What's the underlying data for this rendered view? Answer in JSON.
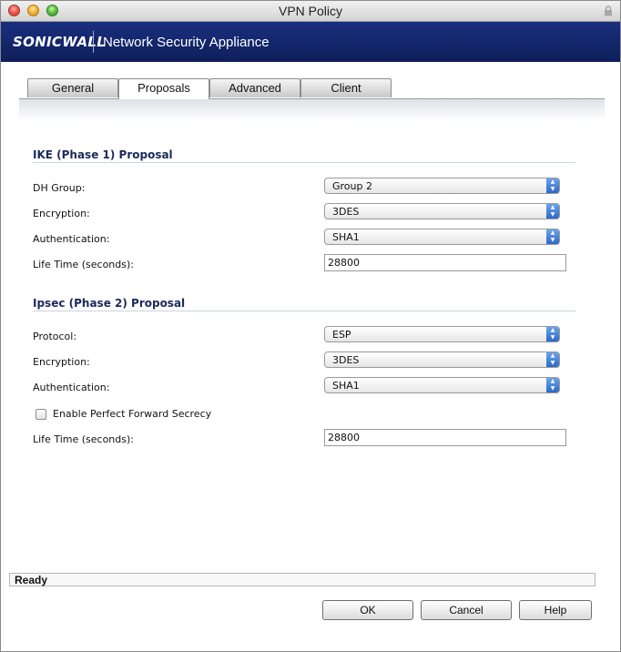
{
  "window": {
    "title": "VPN Policy"
  },
  "brand": {
    "logo": "SONICWALL",
    "product": "Network Security Appliance"
  },
  "tabs": [
    {
      "label": "General",
      "active": false
    },
    {
      "label": "Proposals",
      "active": true
    },
    {
      "label": "Advanced",
      "active": false
    },
    {
      "label": "Client",
      "active": false
    }
  ],
  "ike": {
    "title": "IKE (Phase 1) Proposal",
    "dh_group": {
      "label": "DH Group:",
      "value": "Group 2"
    },
    "encryption": {
      "label": "Encryption:",
      "value": "3DES"
    },
    "authentication": {
      "label": "Authentication:",
      "value": "SHA1"
    },
    "lifetime": {
      "label": "Life Time (seconds):",
      "value": "28800"
    }
  },
  "ipsec": {
    "title": "Ipsec (Phase 2) Proposal",
    "protocol": {
      "label": "Protocol:",
      "value": "ESP"
    },
    "encryption": {
      "label": "Encryption:",
      "value": "3DES"
    },
    "authentication": {
      "label": "Authentication:",
      "value": "SHA1"
    },
    "pfs": {
      "label": "Enable Perfect Forward Secrecy",
      "checked": false
    },
    "lifetime": {
      "label": "Life Time (seconds):",
      "value": "28800"
    }
  },
  "status": {
    "text": "Ready"
  },
  "buttons": {
    "ok": "OK",
    "cancel": "Cancel",
    "help": "Help"
  },
  "colors": {
    "brand_bar": "#0e1f5a",
    "section_title": "#1c2a5c",
    "select_arrow": "#2c69c9"
  }
}
